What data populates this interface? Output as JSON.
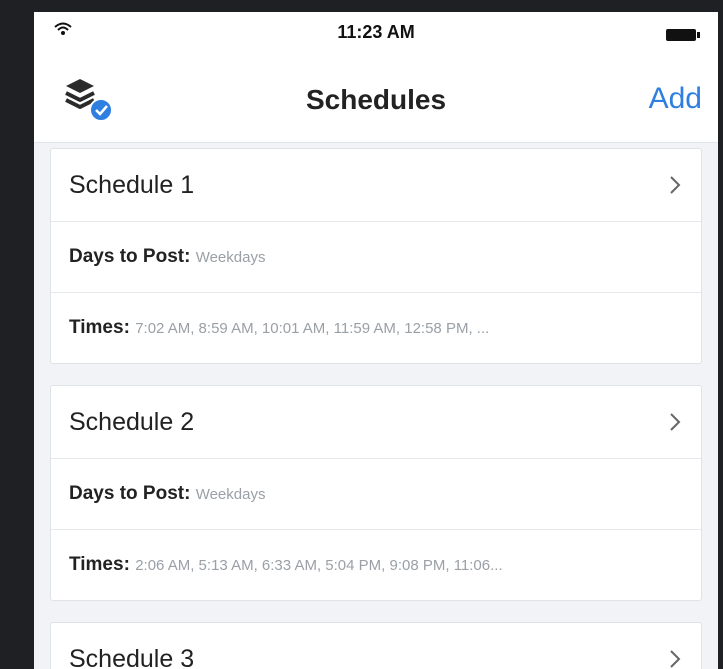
{
  "status": {
    "time": "11:23 AM"
  },
  "nav": {
    "title": "Schedules",
    "add_label": "Add"
  },
  "schedules": [
    {
      "title": "Schedule 1",
      "days_label": "Days to Post:",
      "days_value": "Weekdays",
      "times_label": "Times:",
      "times_value": "7:02 AM,  8:59 AM,  10:01 AM,  11:59 AM,  12:58 PM,  ..."
    },
    {
      "title": "Schedule 2",
      "days_label": "Days to Post:",
      "days_value": "Weekdays",
      "times_label": "Times:",
      "times_value": "2:06 AM,  5:13 AM,  6:33 AM,  5:04 PM,  9:08 PM,  11:06..."
    },
    {
      "title": "Schedule 3"
    }
  ],
  "colors": {
    "accent": "#2f7fe0",
    "background": "#f1f3f6",
    "muted_text": "#9aa0a6"
  },
  "icons": {
    "status": [
      "wifi-icon",
      "battery-icon"
    ],
    "nav": "layers-icon",
    "row": "chevron-right-icon"
  }
}
